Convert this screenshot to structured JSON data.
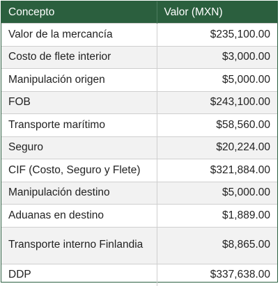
{
  "table": {
    "headers": [
      "Concepto",
      "Valor (MXN)"
    ],
    "rows": [
      {
        "concepto": "Valor de la mercancía",
        "valor": "$235,100.00"
      },
      {
        "concepto": "Costo de flete interior",
        "valor": "$3,000.00"
      },
      {
        "concepto": "Manipulación origen",
        "valor": "$5,000.00"
      },
      {
        "concepto": "FOB",
        "valor": "$243,100.00"
      },
      {
        "concepto": "Transporte marítimo",
        "valor": "$58,560.00"
      },
      {
        "concepto": "Seguro",
        "valor": "$20,224.00"
      },
      {
        "concepto": "CIF (Costo, Seguro y Flete)",
        "valor": "$321,884.00"
      },
      {
        "concepto": "Manipulación destino",
        "valor": "$5,000.00"
      },
      {
        "concepto": "Aduanas en destino",
        "valor": "$1,889.00"
      },
      {
        "concepto": "Transporte interno Finlandia",
        "valor": "$8,865.00"
      },
      {
        "concepto": "DDP",
        "valor": "$337,638.00"
      }
    ]
  },
  "colors": {
    "header_bg": "#2b5f3e",
    "header_text": "#ffffff",
    "stripe": "#f2f2f2"
  }
}
